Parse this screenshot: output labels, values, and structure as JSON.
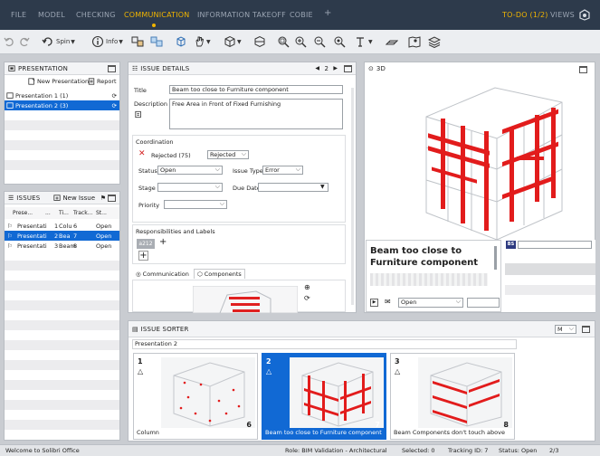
{
  "menu": {
    "items": [
      "FILE",
      "MODEL",
      "CHECKING",
      "COMMUNICATION",
      "INFORMATION TAKEOFF",
      "COBIE"
    ],
    "add": "+",
    "todo": "TO-DO (1/2)",
    "views": "VIEWS"
  },
  "toolbar": {
    "spin_label": "Spin",
    "info_label": "Info"
  },
  "presentation": {
    "title": "PRESENTATION",
    "new_label": "New Presentation",
    "report_label": "Report",
    "items": [
      {
        "label": "Presentation 1 (1)",
        "selected": false
      },
      {
        "label": "Presentation 2 (3)",
        "selected": true
      }
    ]
  },
  "issues": {
    "title": "ISSUES",
    "new_label": "New Issue",
    "columns": [
      "Prese...",
      "...",
      "Ti...",
      "Track...",
      "St..."
    ],
    "rows": [
      {
        "presentation": "Presentati",
        "n": "1",
        "title": "Colu",
        "track": "6",
        "status": "Open",
        "selected": false
      },
      {
        "presentation": "Presentati",
        "n": "2",
        "title": "Bea",
        "track": "7",
        "status": "Open",
        "selected": true
      },
      {
        "presentation": "Presentati",
        "n": "3",
        "title": "Beam",
        "track": "8",
        "status": "Open",
        "selected": false
      }
    ]
  },
  "details": {
    "title": "ISSUE DETAILS",
    "nav_index": "2",
    "title_label": "Title",
    "title_value": "Beam too close to Furniture component",
    "description_label": "Description",
    "description_value": "Free Area in Front of Fixed Furnishing",
    "coordination": {
      "label": "Coordination",
      "rejected_label": "Rejected (75)",
      "rejected_select": "Rejected",
      "status_label": "Status",
      "status_value": "Open",
      "issue_type_label": "Issue Type",
      "issue_type_value": "Error",
      "stage_label": "Stage",
      "stage_value": "",
      "due_date_label": "Due Date",
      "due_date_value": "",
      "priority_label": "Priority",
      "priority_value": ""
    },
    "responsibilities_label": "Responsibilities and Labels",
    "tag": "a212",
    "add": "+",
    "tabs": [
      "Communication",
      "Components"
    ]
  },
  "view3d": {
    "title": "3D",
    "info_title": "Beam too close to Furniture component",
    "info_status": "Open",
    "badge": "BS"
  },
  "sorter": {
    "title": "ISSUE SORTER",
    "group": "Presentation 2",
    "dropdown": "M",
    "cards": [
      {
        "num": "1",
        "count": "6",
        "caption": "Column",
        "selected": false
      },
      {
        "num": "2",
        "count": "7",
        "caption": "Beam too close to Furniture component",
        "selected": true
      },
      {
        "num": "3",
        "count": "8",
        "caption": "Beam Components don't touch above",
        "selected": false
      }
    ]
  },
  "status": {
    "welcome": "Welcome to Solibri Office",
    "role": "Role: BIM Validation - Architectural",
    "selected": "Selected: 0",
    "tracking": "Tracking ID: 7",
    "status": "Status: Open",
    "pages": "2/3"
  }
}
